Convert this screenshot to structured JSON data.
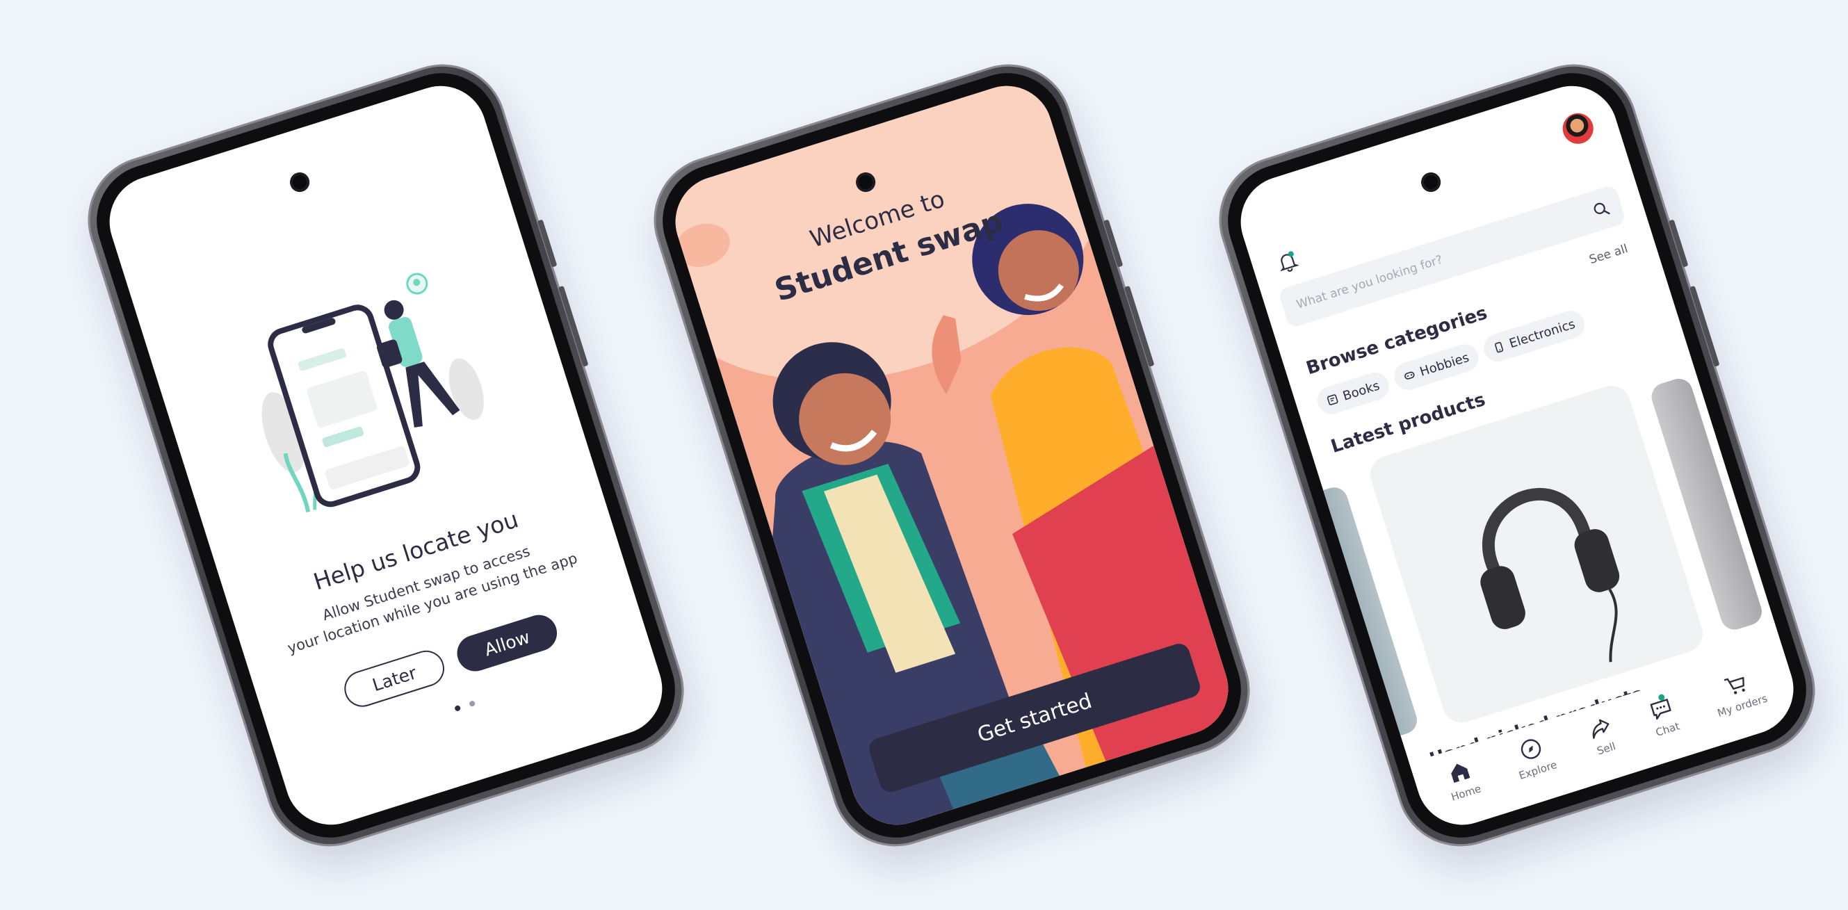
{
  "colors": {
    "background": "#f1f5fc",
    "navy": "#2c2d44",
    "accent_teal": "#6fd6c0",
    "welcome_bg": "#f8b39a"
  },
  "locate_screen": {
    "title": "Help us locate you",
    "description_line1": "Allow Student swap to access",
    "description_line2": "your location while you are using the app",
    "later_label": "Later",
    "allow_label": "Allow",
    "pager_dots": 2,
    "pager_active_index": 0
  },
  "welcome_screen": {
    "welcome_text": "Welcome to",
    "brand_name": "Student swap",
    "cta_label": "Get started"
  },
  "home_screen": {
    "search_placeholder": "What are you looking for?",
    "browse_title": "Browse categories",
    "see_all_label": "See all",
    "categories": [
      {
        "label": "Books",
        "icon": "book-icon"
      },
      {
        "label": "Hobbies",
        "icon": "gamepad-icon"
      },
      {
        "label": "Electronics",
        "icon": "phone-icon"
      }
    ],
    "latest_title": "Latest products",
    "latest_product_image": "headphones",
    "hand_picked_title": "Hand picked products",
    "nav": [
      {
        "label": "Home",
        "icon": "home-icon",
        "active": true
      },
      {
        "label": "Explore",
        "icon": "compass-icon"
      },
      {
        "label": "Sell",
        "icon": "share-icon"
      },
      {
        "label": "Chat",
        "icon": "chat-icon",
        "badge": true
      },
      {
        "label": "My orders",
        "icon": "cart-icon"
      }
    ]
  }
}
